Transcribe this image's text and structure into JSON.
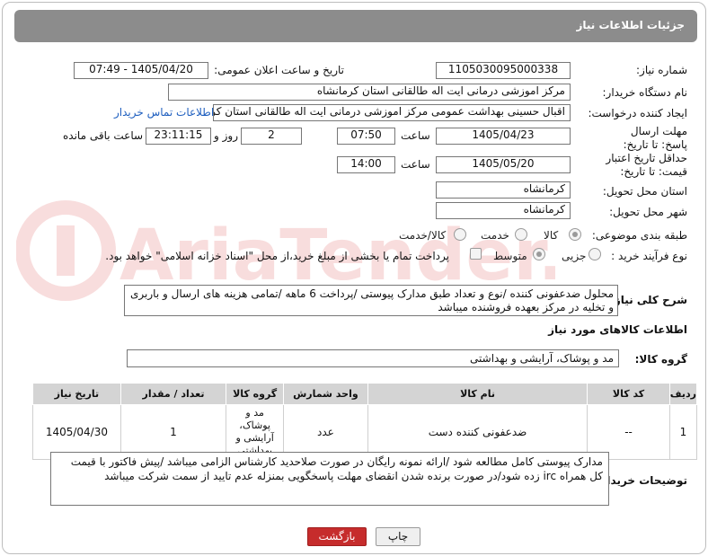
{
  "header": {
    "title": "جزئیات اطلاعات نیاز"
  },
  "fields": {
    "need_number_label": "شماره نیاز:",
    "need_number": "1105030095000338",
    "announce_label": "تاریخ و ساعت اعلان عمومی:",
    "announce_value": "1405/04/20 - 07:49",
    "buyer_org_label": "نام دستگاه خریدار:",
    "buyer_org": "مرکز اموزشی درمانی ایت اله طالقانی استان کرمانشاه",
    "creator_label": "ایجاد کننده درخواست:",
    "creator": "اقبال حسینی بهداشت عمومی مرکز اموزشی درمانی ایت اله طالقانی استان کر",
    "contact_link": "اطلاعات تماس خریدار",
    "deadline_label": "مهلت ارسال پاسخ: تا تاریخ:",
    "deadline_date": "1405/04/23",
    "time_label": "ساعت",
    "deadline_time": "07:50",
    "days_value": "2",
    "days_label": "روز و",
    "remaining_time": "23:11:15",
    "remaining_label": "ساعت باقی مانده",
    "validity_label": "حداقل تاریخ اعتبار قیمت: تا تاریخ:",
    "validity_date": "1405/05/20",
    "validity_time": "14:00",
    "province_label": "استان محل تحویل:",
    "province": "کرمانشاه",
    "city_label": "شهر محل تحویل:",
    "city": "کرمانشاه",
    "category_label": "طبقه بندی موضوعی:",
    "category_goods": "کالا",
    "category_service": "خدمت",
    "category_both": "کالا/خدمت",
    "process_label": "نوع فرآیند خرید :",
    "process_partial": "جزیی",
    "process_medium": "متوسط",
    "payment_note": "پرداخت تمام یا بخشی از مبلغ خرید،از محل \"اسناد خزانه اسلامی\" خواهد بود."
  },
  "description": {
    "label": "شرح کلی نیاز:",
    "text": "محلول ضدعفونی کننده /نوع و تعداد طبق مدارک پیوستی /پرداخت 6 ماهه /تمامی هزینه های ارسال و باربری و تخلیه در مرکز بعهده فروشنده میباشد"
  },
  "goods_info": {
    "title": "اطلاعات کالاهای مورد نیاز",
    "group_label": "گروه کالا:",
    "group_value": "مد و پوشاک، آرایشی و بهداشتی"
  },
  "table": {
    "headers": [
      "ردیف",
      "کد کالا",
      "نام کالا",
      "واحد شمارش",
      "گروه کالا",
      "تعداد / مقدار",
      "تاریخ نیاز"
    ],
    "rows": [
      [
        "1",
        "--",
        "ضدعفونی کننده دست",
        "عدد",
        "مد و پوشاک، آرایشی و بهداشتی",
        "1",
        "1405/04/30"
      ]
    ]
  },
  "buyer_notes": {
    "label": "توضیحات خریدار:",
    "text": "مدارک پیوستی کامل مطالعه شود /ارائه نمونه رایگان در صورت صلاحدید کارشناس الزامی میباشد /پیش فاکتور با قیمت کل همراه irc زده شود/در صورت برنده شدن انقضای مهلت پاسخگویی بمنزله عدم تایید از سمت شرکت میباشد"
  },
  "buttons": {
    "back": "بازگشت",
    "print": "چاپ"
  },
  "watermark": {
    "text": "AriaTender.net"
  },
  "colors": {
    "header_bg": "#8c8c8c",
    "back_button": "#c62c2c",
    "link": "#1f5fbf"
  }
}
